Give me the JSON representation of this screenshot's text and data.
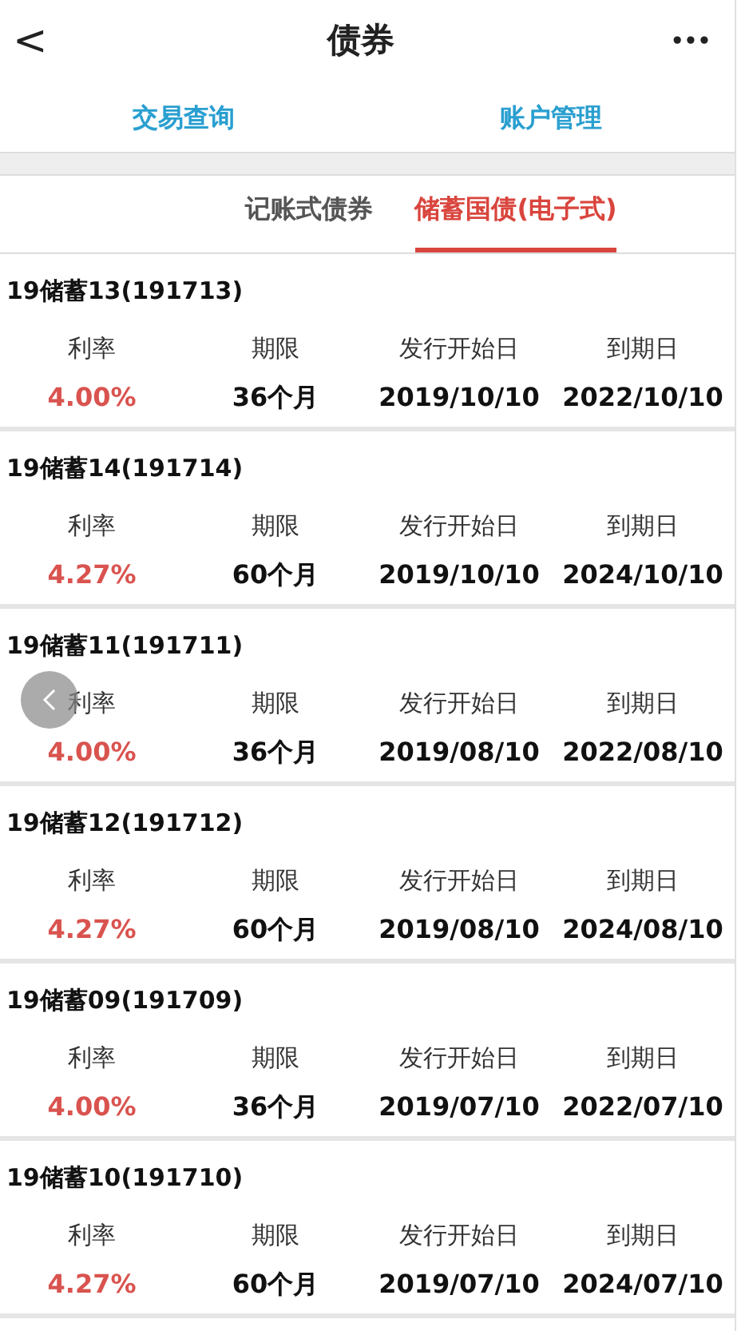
{
  "header": {
    "back": "<",
    "title": "债券",
    "more": "•••"
  },
  "top_links": [
    {
      "label": "交易查询"
    },
    {
      "label": "账户管理"
    }
  ],
  "tabs": [
    {
      "label": "记账式债券",
      "selected": false
    },
    {
      "label": "储蓄国债(电子式)",
      "selected": true
    }
  ],
  "bonds": [
    {
      "name": "19储蓄13(191713)",
      "fields": [
        {
          "kind": "rate",
          "label": "利率",
          "value": "4.00%"
        },
        {
          "kind": "plain",
          "label": "期限",
          "value": "36个月"
        },
        {
          "kind": "plain",
          "label": "发行开始日",
          "value": "2019/10/10"
        },
        {
          "kind": "plain",
          "label": "到期日",
          "value": "2022/10/10"
        }
      ]
    },
    {
      "name": "19储蓄14(191714)",
      "fields": [
        {
          "kind": "rate",
          "label": "利率",
          "value": "4.27%"
        },
        {
          "kind": "plain",
          "label": "期限",
          "value": "60个月"
        },
        {
          "kind": "plain",
          "label": "发行开始日",
          "value": "2019/10/10"
        },
        {
          "kind": "plain",
          "label": "到期日",
          "value": "2024/10/10"
        }
      ]
    },
    {
      "name": "19储蓄11(191711)",
      "fields": [
        {
          "kind": "rate",
          "label": "利率",
          "value": "4.00%"
        },
        {
          "kind": "plain",
          "label": "期限",
          "value": "36个月"
        },
        {
          "kind": "plain",
          "label": "发行开始日",
          "value": "2019/08/10"
        },
        {
          "kind": "plain",
          "label": "到期日",
          "value": "2022/08/10"
        }
      ]
    },
    {
      "name": "19储蓄12(191712)",
      "fields": [
        {
          "kind": "rate",
          "label": "利率",
          "value": "4.27%"
        },
        {
          "kind": "plain",
          "label": "期限",
          "value": "60个月"
        },
        {
          "kind": "plain",
          "label": "发行开始日",
          "value": "2019/08/10"
        },
        {
          "kind": "plain",
          "label": "到期日",
          "value": "2024/08/10"
        }
      ]
    },
    {
      "name": "19储蓄09(191709)",
      "fields": [
        {
          "kind": "rate",
          "label": "利率",
          "value": "4.00%"
        },
        {
          "kind": "plain",
          "label": "期限",
          "value": "36个月"
        },
        {
          "kind": "plain",
          "label": "发行开始日",
          "value": "2019/07/10"
        },
        {
          "kind": "plain",
          "label": "到期日",
          "value": "2022/07/10"
        }
      ]
    },
    {
      "name": "19储蓄10(191710)",
      "fields": [
        {
          "kind": "rate",
          "label": "利率",
          "value": "4.27%"
        },
        {
          "kind": "plain",
          "label": "期限",
          "value": "60个月"
        },
        {
          "kind": "plain",
          "label": "发行开始日",
          "value": "2019/07/10"
        },
        {
          "kind": "plain",
          "label": "到期日",
          "value": "2024/07/10"
        }
      ]
    }
  ]
}
